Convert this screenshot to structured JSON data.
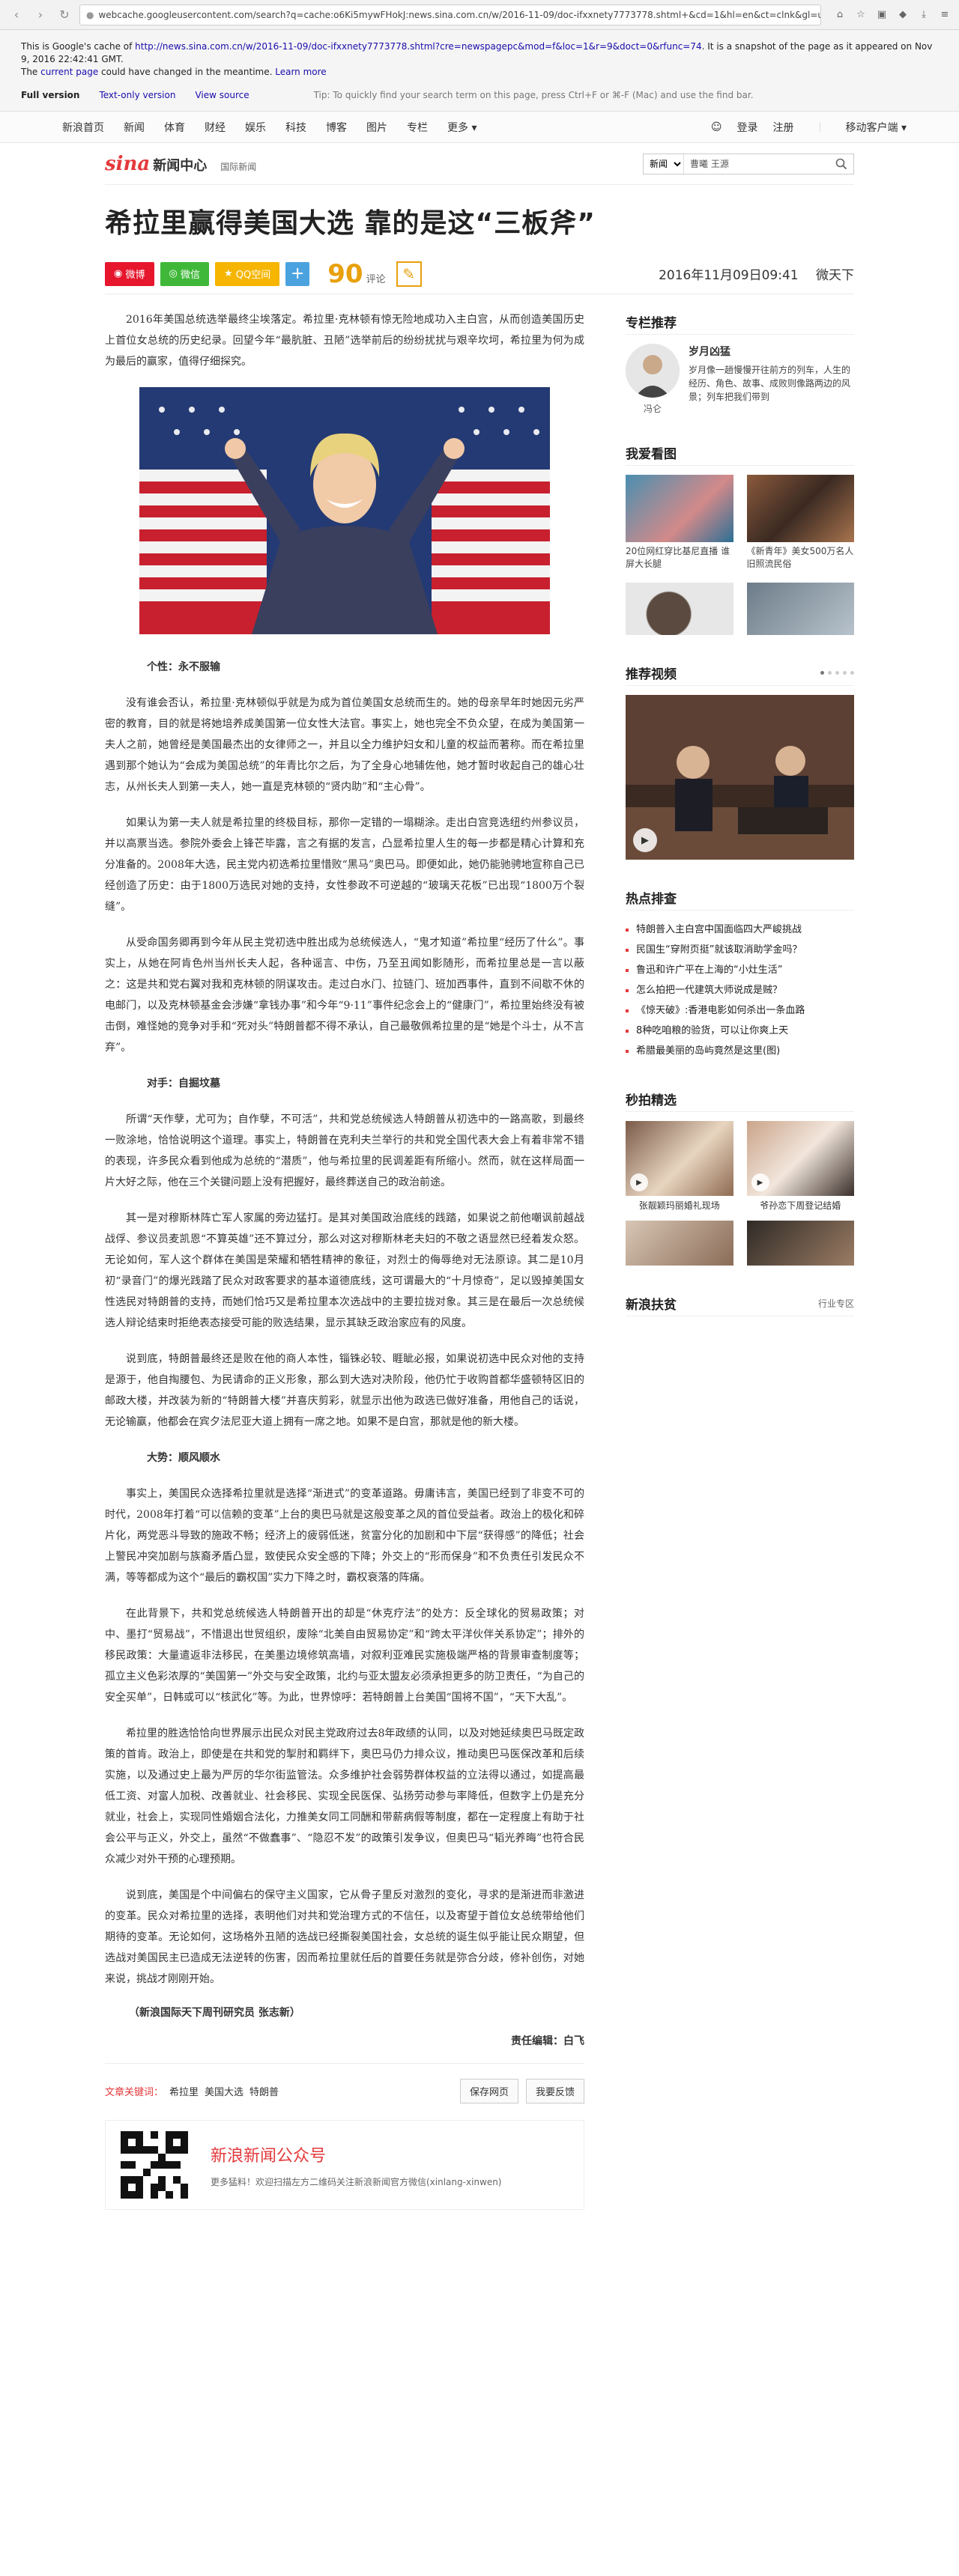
{
  "browser": {
    "url": "webcache.googleusercontent.com/search?q=cache:o6Ki5mywFHokJ:news.sina.com.cn/w/2016-11-09/doc-ifxxnety7773778.shtml+&cd=1&hl=en&ct=clnk&gl=us&client=safari",
    "icons": [
      "back-icon",
      "forward-icon",
      "reload-icon",
      "home-icon",
      "star-icon",
      "puzzle-icon",
      "shield-icon",
      "download-icon",
      "menu-icon"
    ]
  },
  "cache": {
    "line1_prefix": "This is Google's cache of ",
    "line1_link": "http://news.sina.com.cn/w/2016-11-09/doc-ifxxnety7773778.shtml?cre=newspagepc&mod=f&loc=1&r=9&doct=0&rfunc=74",
    "line1_suffix": ". It is a snapshot of the page as it appeared on Nov 9, 2016 22:42:41 GMT.",
    "line2_prefix": "The ",
    "line2_link": "current page",
    "line2_suffix": " could have changed in the meantime. ",
    "learn_more": "Learn more",
    "tab_full": "Full version",
    "tab_text": "Text-only version",
    "tab_source": "View source",
    "tip": "Tip: To quickly find your search term on this page, press Ctrl+F or ⌘-F (Mac) and use the find bar."
  },
  "topnav": {
    "items": [
      "新浪首页",
      "新闻",
      "体育",
      "财经",
      "娱乐",
      "科技",
      "博客",
      "图片",
      "专栏",
      "更多"
    ],
    "login": "登录",
    "register": "注册",
    "mobile": "移动客户端"
  },
  "header": {
    "logo_sina": "sina",
    "logo_channel": "新闻中心",
    "logo_sub": "国际新闻",
    "search_scope": "新闻",
    "search_value": "曹曦 王源"
  },
  "article": {
    "title": "希拉里赢得美国大选 靠的是这“三板斧”",
    "share_weibo": "微博",
    "share_wechat": "微信",
    "share_qzone": "QQ空间",
    "comment_count": "90",
    "comment_label": "评论",
    "date": "2016年11月09日09:41",
    "source": "微天下",
    "intro": "2016年美国总统选举最终尘埃落定。希拉里·克林顿有惊无险地成功入主白宫，从而创造美国历史上首位女总统的历史纪录。回望今年“最肮脏、丑陋”选举前后的纷纷扰扰与艰辛坎坷，希拉里为何为成为最后的赢家，值得仔细探究。",
    "sub1": "个性：永不服输",
    "p1": "没有谁会否认，希拉里·克林顿似乎就是为成为首位美国女总统而生的。她的母亲早年时她因元劣严密的教育，目的就是将她培养成美国第一位女性大法官。事实上，她也完全不负众望，在成为美国第一夫人之前，她曾经是美国最杰出的女律师之一，并且以全力维护妇女和儿童的权益而著称。而在希拉里遇到那个她认为“会成为美国总统”的年青比尔之后，为了全身心地辅佐他，她才暂时收起自己的雄心壮志，从州长夫人到第一夫人，她一直是克林顿的“贤内助”和“主心骨”。",
    "p2": "如果认为第一夫人就是希拉里的终极目标，那你一定错的一塌糊涂。走出白宫竞选纽约州参议员，并以高票当选。参院外委会上锋芒毕露，言之有据的发言，凸显希拉里人生的每一步都是精心计算和充分准备的。2008年大选，民主党内初选希拉里惜败“黑马”奥巴马。即便如此，她仍能驰骋地宣称自己已经创造了历史：由于1800万选民对她的支持，女性参政不可逆越的“玻璃天花板”已出现“1800万个裂缝”。",
    "p3": "从受命国务卿再到今年从民主党初选中胜出成为总统候选人，“鬼才知道”希拉里“经历了什么”。事实上，从她在阿肯色州当州长夫人起，各种谣言、中伤，乃至丑闻如影随形，而希拉里总是一言以蔽之：这是共和党右翼对我和克林顿的阴谋攻击。走过白水门、拉链门、班加西事件，直到不间歇不休的电邮门，以及克林顿基金会涉嫌“拿钱办事”和今年“9·11”事件纪念会上的“健康门”，希拉里始终没有被击倒，难怪她的竞争对手和“死对头”特朗普都不得不承认，自己最敬佩希拉里的是“她是个斗士，从不言弃”。",
    "sub2": "对手：自掘坟墓",
    "p4": "所谓“天作孽，尤可为；自作孽，不可活”，共和党总统候选人特朗普从初选中的一路高歌，到最终一败涂地，恰恰说明这个道理。事实上，特朗普在克利夫兰举行的共和党全国代表大会上有着非常不错的表现，许多民众看到他成为总统的“潜质”，他与希拉里的民调差距有所缩小。然而，就在这样局面一片大好之际，他在三个关键问题上没有把握好，最终葬送自己的政治前途。",
    "p5": "其一是对穆斯林阵亡军人家属的旁边猛打。是其对美国政治底线的践踏，如果说之前他嘲讽前越战战俘、参议员麦凯恩“不算英雄”还不算过分，那么对这对穆斯林老夫妇的不敬之语显然已经着发众怒。无论如何，军人这个群体在美国是荣耀和牺牲精神的象征，对烈士的侮辱绝对无法原谅。其二是10月初“录音门”的爆光践踏了民众对政客要求的基本道德底线，这可谓最大的“十月惊奇”，足以毁掉美国女性选民对特朗普的支持，而她们恰巧又是希拉里本次选战中的主要拉拢对象。其三是在最后一次总统候选人辩论结束时拒绝表态接受可能的败选结果，显示其缺乏政治家应有的风度。",
    "p6": "说到底，特朗普最终还是败在他的商人本性，锱铢必较、睚眦必报，如果说初选中民众对他的支持是源于，他自掏腰包、为民请命的正义形象，那么到大选对决阶段，他仍忙于收购首都华盛顿特区旧的邮政大楼，并改装为新的“特朗普大楼”并喜庆剪彩，就显示出他为政选已做好准备，用他自己的话说，无论输赢，他都会在宾夕法尼亚大道上拥有一席之地。如果不是白宫，那就是他的新大楼。",
    "sub3": "大势：顺风顺水",
    "p7": "事实上，美国民众选择希拉里就是选择“渐进式”的变革道路。毋庸讳言，美国已经到了非变不可的时代，2008年打着“可以信赖的变革”上台的奥巴马就是这般变革之风的首位受益者。政治上的极化和碎片化，两党恶斗导致的施政不畅；经济上的疲弱低迷，贫富分化的加剧和中下层“获得感”的降低；社会上警民冲突加剧与族裔矛盾凸显，致使民众安全感的下降；外交上的“形而保身”和不负责任引发民众不满，等等都成为这个“最后的霸权国”实力下降之时，霸权衰落的阵痛。",
    "p8": "在此背景下，共和党总统候选人特朗普开出的却是“休克疗法”的处方：反全球化的贸易政策；对中、墨打“贸易战”，不惜退出世贸组织，废除“北美自由贸易协定”和“跨太平洋伙伴关系协定”；排外的移民政策：大量遣返非法移民，在美墨边境修筑高墙，对叙利亚难民实施极端严格的背景审查制度等；孤立主义色彩浓厚的“美国第一”外交与安全政策，北约与亚太盟友必须承担更多的防卫责任，“为自己的安全买单”，日韩或可以“核武化”等。为此，世界惊呼：若特朗普上台美国“国将不国”，“天下大乱”。",
    "p9": "希拉里的胜选恰恰向世界展示出民众对民主党政府过去8年政绩的认同，以及对她延续奥巴马既定政策的首肯。政治上，即使是在共和党的掣肘和羁绊下，奥巴马仍力排众议，推动奥巴马医保改革和后续实施，以及通过史上最为严厉的华尔街监管法。众多维护社会弱势群体权益的立法得以通过，如提高最低工资、对富人加税、改善就业、社会移民、实现全民医保、弘扬劳动参与率降低，但数字上仍是充分就业，社会上，实现同性婚姻合法化，力推美女同工同酬和带薪病假等制度，都在一定程度上有助于社会公平与正义，外交上，虽然“不做蠢事”、“隐忍不发”的政策引发争议，但奥巴马“韬光养晦”也符合民众减少对外干预的心理预期。",
    "p10": "说到底，美国是个中间偏右的保守主义国家，它从骨子里反对激烈的变化，寻求的是渐进而非激进的变革。民众对希拉里的选择，表明他们对共和党治理方式的不信任，以及寄望于首位女总统带给他们期待的变革。无论如何，这场格外丑陋的选战已经撕裂美国社会，女总统的诞生似乎能让民众期望，但选战对美国民主已造成无法逆转的伤害，因而希拉里就任后的首要任务就是弥合分歧，修补创伤，对她来说，挑战才刚刚开始。",
    "signature": "（新浪国际天下周刊研究员 张志新）",
    "editor": "责任编辑：白飞",
    "keywords_label": "文章关键词：",
    "keywords": [
      "希拉里",
      "美国大选",
      "特朗普"
    ],
    "save_btn": "保存网页",
    "report_btn": "我要反馈",
    "promo_title": "新浪新闻公众号",
    "promo_sub": "更多猛料！欢迎扫描左方二维码关注新浪新闻官方微信(xinlang-xinwen)"
  },
  "sidebar": {
    "column_title": "专栏推荐",
    "column_author_name": "冯仑",
    "column_name": "岁月凶猛",
    "column_desc": "岁月像一趟慢慢开往前方的列车，人生的经历、角色、故事、成败则像路两边的风景；列车把我们带到",
    "pics_title": "我爱看图",
    "pics": [
      "20位网红穿比基尼直播 谁屏大长腿",
      "《新青年》美女500万名人旧照流民俗",
      "",
      ""
    ],
    "video_title": "推荐视频",
    "hot_title": "热点排查",
    "hot": [
      "特朗普入主白宫中国面临四大严峻挑战",
      "民国生“穿附页挺”就该取消助学金吗？",
      "鲁迅和许广平在上海的“小灶生活”",
      "怎么拍把一代建筑大师说成是贼？",
      "《惊天破》:香港电影如何杀出一条血路",
      "8种吃咱粮的验货，可以让你爽上天",
      "希腊最美丽的岛屿竟然是这里(图)"
    ],
    "blog_title": "秒拍精选",
    "blogs": [
      "张靓颖玛丽婚礼现场",
      "爷孙恋下周登记结婚"
    ],
    "fuping_title": "新浪扶贫",
    "fuping_more": "行业专区"
  }
}
